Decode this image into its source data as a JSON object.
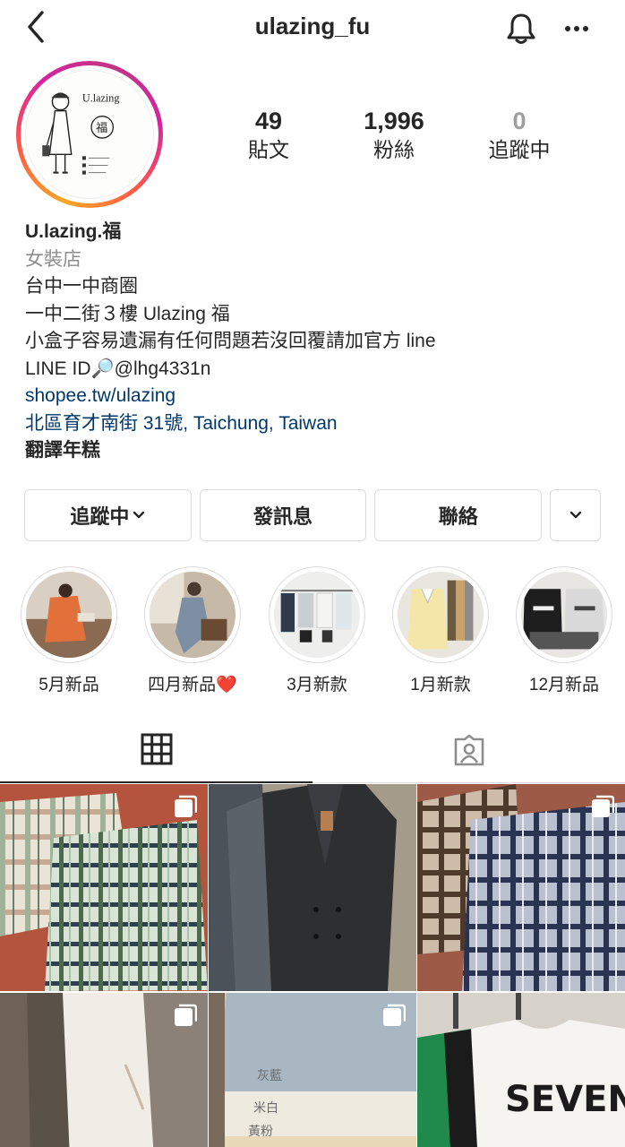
{
  "header": {
    "username": "ulazing_fu"
  },
  "avatar": {
    "brand_text": "U.lazing",
    "seal_char": "福"
  },
  "stats": [
    {
      "value": "49",
      "label": "貼文"
    },
    {
      "value": "1,996",
      "label": "粉絲"
    },
    {
      "value": "0",
      "label": "追蹤中"
    }
  ],
  "bio": {
    "name": "U.lazing.福",
    "category": "女裝店",
    "lines": [
      "台中一中商圈",
      "一中二街３樓 Ulazing 福",
      "小盒子容易遺漏有任何問題若沒回覆請加官方 line",
      "LINE ID🔎@lhg4331n"
    ],
    "website": "shopee.tw/ulazing",
    "address": "北區育才南街 31號, Taichung, Taiwan",
    "translate": "翻譯年糕"
  },
  "buttons": {
    "following": "追蹤中",
    "message": "發訊息",
    "contact": "聯絡"
  },
  "highlights": [
    {
      "label": "5月新品"
    },
    {
      "label": "四月新品❤️"
    },
    {
      "label": "3月新款"
    },
    {
      "label": "1月新款"
    },
    {
      "label": "12月新品"
    }
  ],
  "grid_tags": {
    "tile5": [
      "灰藍",
      "米白",
      "黃粉"
    ],
    "tile6_print": "SEVEN"
  },
  "colors": {
    "link": "#00376b",
    "text": "#262626",
    "muted": "#8e8e8e",
    "border": "#dbdbdb"
  }
}
